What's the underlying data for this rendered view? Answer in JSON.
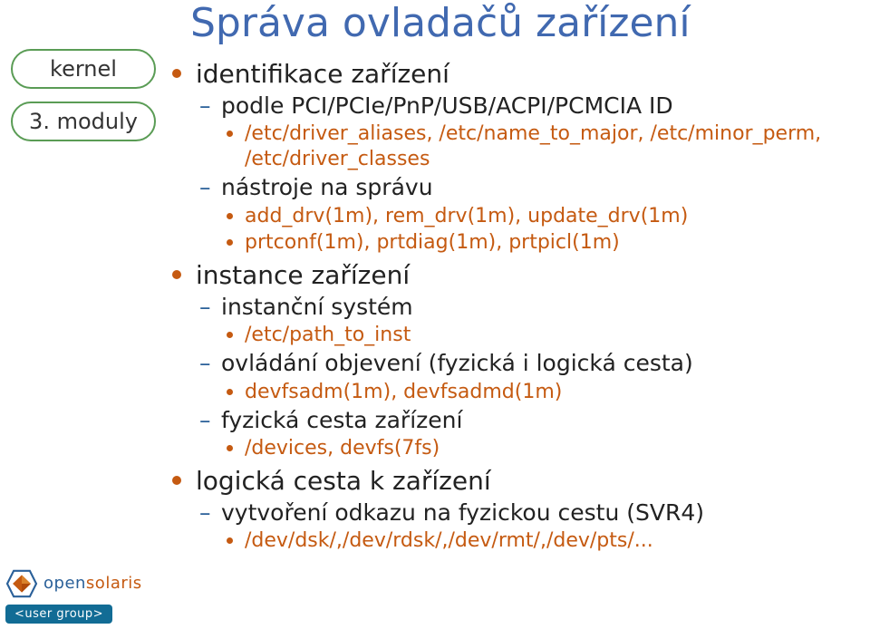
{
  "title": "Správa ovladačů zařízení",
  "side": {
    "pill1": "kernel",
    "pill2": "3. moduly"
  },
  "b1": {
    "t": "identifikace zařízení",
    "s1": {
      "t": "podle PCI/PCIe/PnP/USB/ACPI/PCMCIA ID",
      "p1": "/etc/driver_aliases, /etc/name_to_major, /etc/minor_perm, /etc/driver_classes"
    },
    "s2": {
      "t": "nástroje na správu",
      "p1": "add_drv(1m), rem_drv(1m), update_drv(1m)",
      "p2": "prtconf(1m), prtdiag(1m), prtpicl(1m)"
    }
  },
  "b2": {
    "t": "instance zařízení",
    "s1": {
      "t": "instanční systém",
      "p1": "/etc/path_to_inst"
    },
    "s2": {
      "t": "ovládání objevení (fyzická i logická cesta)",
      "p1": "devfsadm(1m), devfsadmd(1m)"
    },
    "s3": {
      "t": "fyzická cesta zařízení",
      "p1": "/devices, devfs(7fs)"
    }
  },
  "b3": {
    "t": "logická cesta k zařízení",
    "s1": {
      "t": "vytvoření odkazu na fyzickou cestu (SVR4)",
      "p1": "/dev/dsk/,/dev/rdsk/,/dev/rmt/,/dev/pts/..."
    }
  },
  "logo": {
    "open": "open",
    "solaris": "solaris",
    "badge": "<user group>"
  }
}
